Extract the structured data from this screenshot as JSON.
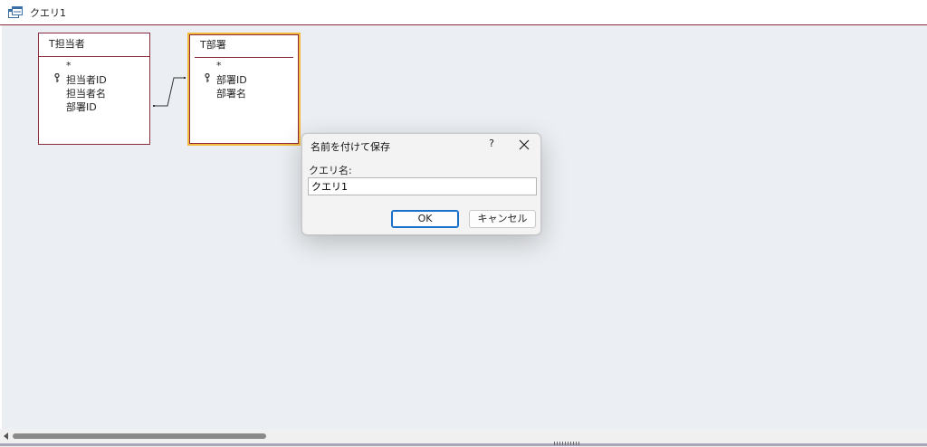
{
  "window": {
    "title": "クエリ1",
    "icon": "query-icon"
  },
  "tables": [
    {
      "name": "T担当者",
      "fields": [
        "*",
        "担当者ID",
        "担当者名",
        "部署ID"
      ],
      "primary_key": "担当者ID"
    },
    {
      "name": "T部署",
      "fields": [
        "*",
        "部署ID",
        "部署名"
      ],
      "primary_key": "部署ID"
    }
  ],
  "dialog": {
    "title": "名前を付けて保存",
    "help": "?",
    "label": "クエリ名:",
    "input_value": "クエリ1",
    "ok_label": "OK",
    "cancel_label": "キャンセル"
  },
  "colors": {
    "border": "#8b2b3e",
    "selected": "#f5b93e",
    "surface": "#ebeef2",
    "accent": "#1a6fc9"
  }
}
